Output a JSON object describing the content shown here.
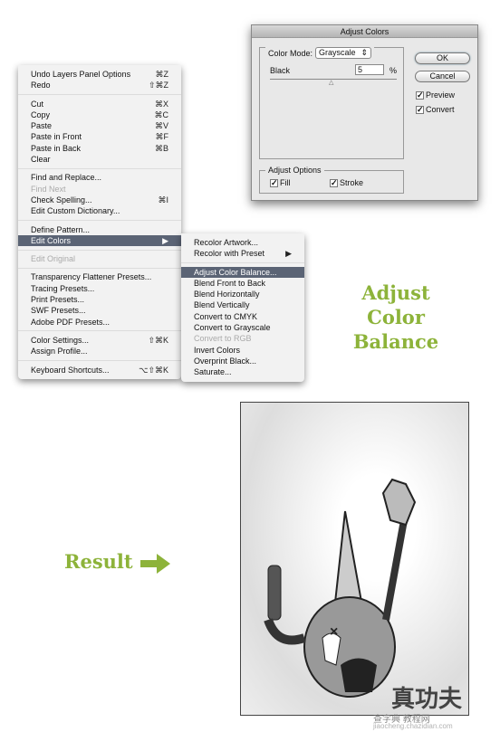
{
  "dialog": {
    "title": "Adjust Colors",
    "color_mode_label": "Color Mode:",
    "color_mode_value": "Grayscale",
    "black_label": "Black",
    "black_value": "5",
    "percent": "%",
    "black_level_percent": 5,
    "ok": "OK",
    "cancel": "Cancel",
    "preview": "Preview",
    "convert": "Convert",
    "adjust_options": "Adjust Options",
    "fill": "Fill",
    "stroke": "Stroke"
  },
  "menu": {
    "groups": [
      [
        {
          "label": "Undo Layers Panel Options",
          "sc": "⌘Z"
        },
        {
          "label": "Redo",
          "sc": "⇧⌘Z"
        }
      ],
      [
        {
          "label": "Cut",
          "sc": "⌘X"
        },
        {
          "label": "Copy",
          "sc": "⌘C"
        },
        {
          "label": "Paste",
          "sc": "⌘V"
        },
        {
          "label": "Paste in Front",
          "sc": "⌘F"
        },
        {
          "label": "Paste in Back",
          "sc": "⌘B"
        },
        {
          "label": "Clear",
          "sc": ""
        }
      ],
      [
        {
          "label": "Find and Replace...",
          "sc": ""
        },
        {
          "label": "Find Next",
          "sc": "",
          "disabled": true
        },
        {
          "label": "Check Spelling...",
          "sc": "⌘I"
        },
        {
          "label": "Edit Custom Dictionary...",
          "sc": ""
        }
      ],
      [
        {
          "label": "Define Pattern...",
          "sc": ""
        },
        {
          "label": "Edit Colors",
          "sc": "▶",
          "highlighted": true
        }
      ],
      [
        {
          "label": "Edit Original",
          "sc": "",
          "disabled": true
        }
      ],
      [
        {
          "label": "Transparency Flattener Presets...",
          "sc": ""
        },
        {
          "label": "Tracing Presets...",
          "sc": ""
        },
        {
          "label": "Print Presets...",
          "sc": ""
        },
        {
          "label": "SWF Presets...",
          "sc": ""
        },
        {
          "label": "Adobe PDF Presets...",
          "sc": ""
        }
      ],
      [
        {
          "label": "Color Settings...",
          "sc": "⇧⌘K"
        },
        {
          "label": "Assign Profile...",
          "sc": ""
        }
      ],
      [
        {
          "label": "Keyboard Shortcuts...",
          "sc": "⌥⇧⌘K"
        }
      ]
    ]
  },
  "submenu": {
    "groups": [
      [
        {
          "label": "Recolor Artwork...",
          "sc": ""
        },
        {
          "label": "Recolor with Preset",
          "sc": "▶"
        }
      ],
      [
        {
          "label": "Adjust Color Balance...",
          "sc": "",
          "highlighted": true
        },
        {
          "label": "Blend Front to Back",
          "sc": ""
        },
        {
          "label": "Blend Horizontally",
          "sc": ""
        },
        {
          "label": "Blend Vertically",
          "sc": ""
        },
        {
          "label": "Convert to CMYK",
          "sc": ""
        },
        {
          "label": "Convert to Grayscale",
          "sc": ""
        },
        {
          "label": "Convert to RGB",
          "sc": "",
          "disabled": true
        },
        {
          "label": "Invert Colors",
          "sc": ""
        },
        {
          "label": "Overprint Black...",
          "sc": ""
        },
        {
          "label": "Saturate...",
          "sc": ""
        }
      ]
    ]
  },
  "caption": {
    "line1": "Adjust",
    "line2": "Color Balance",
    "color": "#8db33a"
  },
  "result": {
    "label": "Result",
    "arrow": "arrow-right-icon"
  },
  "watermark": {
    "text": "真功夫",
    "sub": "查字典 教程网",
    "url": "jiaocheng.chazidian.com"
  }
}
